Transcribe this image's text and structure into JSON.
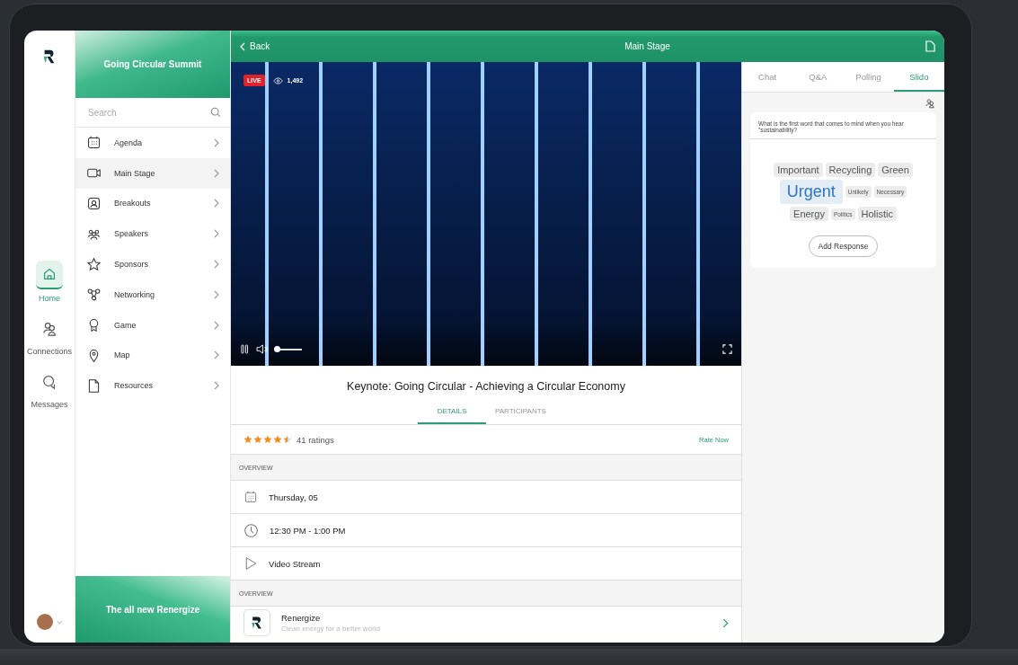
{
  "rail": {
    "items": [
      {
        "label": "Home",
        "selected": true
      },
      {
        "label": "Connections",
        "selected": false
      },
      {
        "label": "Messages",
        "selected": false
      }
    ]
  },
  "sidebar": {
    "title": "Going Circular Summit",
    "search": {
      "placeholder": "Search"
    },
    "items": [
      {
        "label": "Agenda",
        "selected": false
      },
      {
        "label": "Main Stage",
        "selected": true
      },
      {
        "label": "Breakouts",
        "selected": false
      },
      {
        "label": "Speakers",
        "selected": false
      },
      {
        "label": "Sponsors",
        "selected": false
      },
      {
        "label": "Networking",
        "selected": false
      },
      {
        "label": "Game",
        "selected": false
      },
      {
        "label": "Map",
        "selected": false
      },
      {
        "label": "Resources",
        "selected": false
      }
    ],
    "banner": "The all new Renergize"
  },
  "header": {
    "back": "Back",
    "title": "Main Stage"
  },
  "video": {
    "live": "LIVE",
    "viewers": "1,492",
    "progress": {
      "level": 0
    }
  },
  "session": {
    "title": "Keynote: Going Circular - Achieving a Circular Economy",
    "tabs": [
      {
        "label": "DETAILS",
        "selected": true
      },
      {
        "label": "PARTICIPANTS",
        "selected": false
      }
    ],
    "rating": {
      "stars": 4.5,
      "count": "41 ratings",
      "action": "Rate Now"
    },
    "sections": [
      {
        "heading": "OVERVIEW",
        "rows": [
          {
            "kind": "date",
            "title": "Thursday, 05"
          },
          {
            "kind": "time",
            "title": "12:30 PM - 1:00 PM"
          },
          {
            "kind": "stream",
            "title": "Video Stream"
          }
        ]
      },
      {
        "heading": "OVERVIEW",
        "rows": [
          {
            "kind": "sponsor",
            "title": "Renergize",
            "subtitle": "Clean energy for a better world"
          }
        ]
      }
    ]
  },
  "panel": {
    "tabs": [
      {
        "label": "Chat",
        "selected": false
      },
      {
        "label": "Q&A",
        "selected": false
      },
      {
        "label": "Polling",
        "selected": false
      },
      {
        "label": "Slido",
        "selected": true
      }
    ],
    "question": "What is the first word that comes to mind when you hear \"sustainability?",
    "cloud": {
      "words": [
        {
          "word": "Important",
          "kind": "medium"
        },
        {
          "word": "Recycling",
          "kind": "medium"
        },
        {
          "word": "Green",
          "kind": "medium"
        },
        {
          "word": "Urgent",
          "kind": "top"
        },
        {
          "word": "Unlikely",
          "kind": "small"
        },
        {
          "word": "Necessary",
          "kind": "small"
        },
        {
          "word": "Energy",
          "kind": "medium"
        },
        {
          "word": "Politics",
          "kind": "small"
        },
        {
          "word": "Holistic",
          "kind": "medium"
        }
      ]
    },
    "button": "Add Response"
  }
}
